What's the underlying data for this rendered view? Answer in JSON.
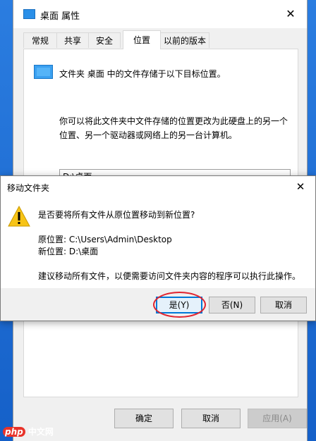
{
  "props_window": {
    "title": "桌面 属性",
    "close_glyph": "✕",
    "tabs": [
      {
        "label": "常规",
        "active": false
      },
      {
        "label": "共享",
        "active": false
      },
      {
        "label": "安全",
        "active": false
      },
      {
        "label": "位置",
        "active": true
      },
      {
        "label": "以前的版本",
        "active": false
      }
    ],
    "location_line": "文件夹 桌面 中的文件存储于以下目标位置。",
    "description": "你可以将此文件夹中文件存储的位置更改为此硬盘上的另一个位置、另一个驱动器或网络上的另一台计算机。",
    "path_value": "D:\\桌面",
    "buttons": {
      "ok": "确定",
      "cancel": "取消",
      "apply": "应用(A)"
    }
  },
  "move_dialog": {
    "title": "移动文件夹",
    "close_glyph": "✕",
    "question": "是否要将所有文件从原位置移动到新位置?",
    "source": "原位置: C:\\Users\\Admin\\Desktop",
    "destination": "新位置: D:\\桌面",
    "advice": "建议移动所有文件，以便需要访问文件夹内容的程序可以执行此操作。",
    "buttons": {
      "yes": "是(Y)",
      "no": "否(N)",
      "cancel": "取消"
    }
  },
  "watermark": {
    "logo": "php",
    "site": "中文网"
  },
  "icons": {
    "warning": "warning-icon",
    "folder": "folder-icon"
  },
  "colors": {
    "accent": "#0078d7",
    "highlight_ring": "#e0232f",
    "desktop": "#1c6bd6"
  }
}
